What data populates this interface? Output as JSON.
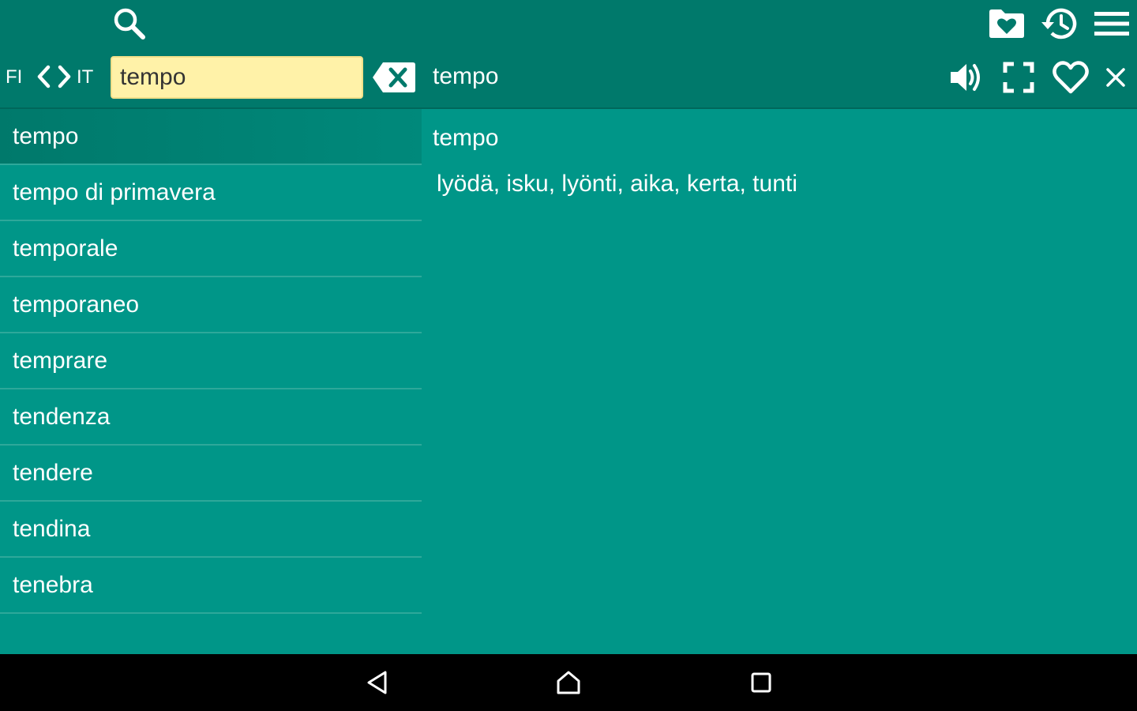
{
  "toolbar": {
    "search_icon": "search-icon",
    "favorites_folder_icon": "folder-heart-icon",
    "history_icon": "history-icon",
    "menu_icon": "hamburger-menu-icon"
  },
  "language": {
    "from": "FI",
    "to": "IT",
    "swap_icon": "chevron-left-right-icon"
  },
  "search": {
    "value": "tempo",
    "clear_icon": "backspace-x-icon"
  },
  "detail": {
    "header_word": "tempo",
    "word": "tempo",
    "translation": "lyödä, isku, lyönti, aika, kerta, tunti",
    "actions": {
      "speak_icon": "speaker-icon",
      "fullscreen_icon": "fullscreen-icon",
      "favorite_icon": "heart-outline-icon",
      "close_icon": "close-icon"
    }
  },
  "word_list": {
    "selected_index": 0,
    "items": [
      {
        "label": "tempo"
      },
      {
        "label": "tempo di primavera"
      },
      {
        "label": "temporale"
      },
      {
        "label": "temporaneo"
      },
      {
        "label": "temprare"
      },
      {
        "label": "tendenza"
      },
      {
        "label": "tendere"
      },
      {
        "label": "tendina"
      },
      {
        "label": "tenebra"
      }
    ]
  },
  "navbar": {
    "back_icon": "back-triangle-icon",
    "home_icon": "home-icon",
    "recents_icon": "recents-square-icon"
  },
  "colors": {
    "appbar": "#00796b",
    "background": "#009688",
    "search_field": "#fff2a8",
    "navbar": "#000000"
  }
}
